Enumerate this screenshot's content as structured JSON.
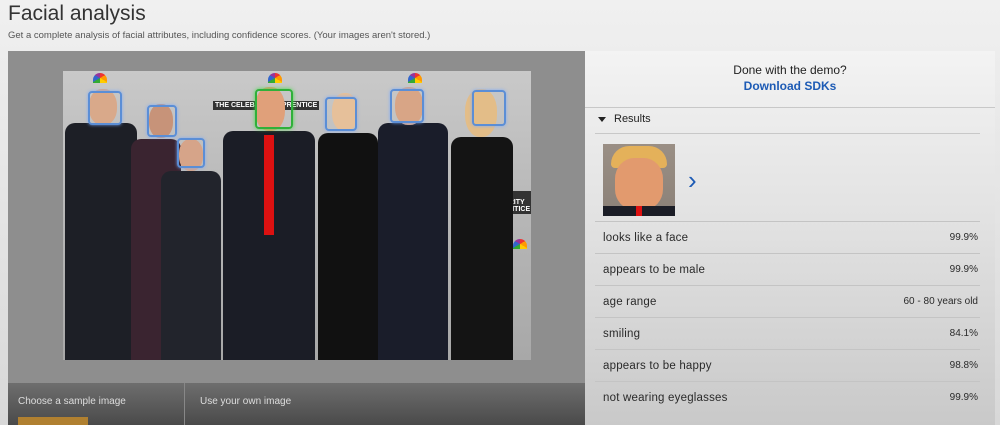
{
  "header": {
    "title": "Facial analysis",
    "subtitle": "Get a complete analysis of facial attributes, including confidence scores. (Your images aren't stored.)"
  },
  "demo": {
    "done_text": "Done with the demo?",
    "download_label": "Download SDKs"
  },
  "results": {
    "toggle_label": "Results",
    "attributes": [
      {
        "name": "looks like a face",
        "value": "99.9%"
      },
      {
        "name": "appears to be male",
        "value": "99.9%"
      },
      {
        "name": "age range",
        "value": "60 - 80 years old"
      },
      {
        "name": "smiling",
        "value": "84.1%"
      },
      {
        "name": "appears to be happy",
        "value": "98.8%"
      },
      {
        "name": "not wearing eyeglasses",
        "value": "99.9%"
      }
    ]
  },
  "samples": {
    "sample_label": "Choose a sample image",
    "own_label": "Use your own image"
  },
  "backdrop": {
    "logo_text": "THE CELEBRITY APPRENTICE"
  },
  "colors": {
    "accent_blue": "#1d5bb5",
    "face_box": "#5b8ed6",
    "selected_face_box": "#2fb03a"
  }
}
